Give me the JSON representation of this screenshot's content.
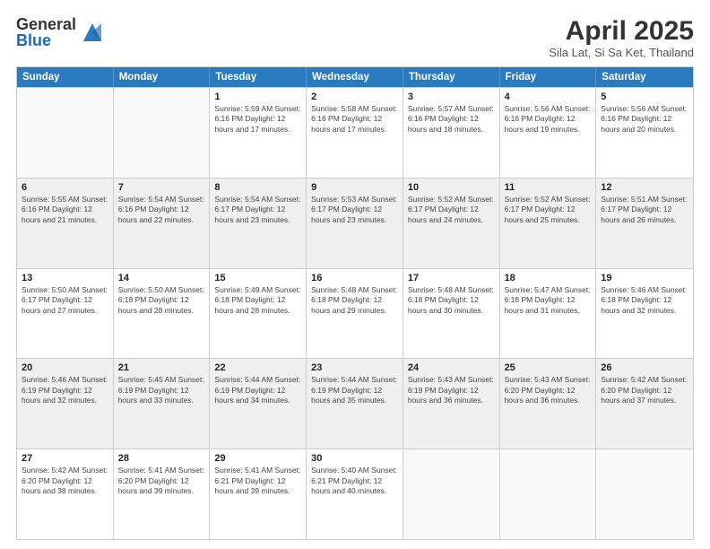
{
  "header": {
    "logo_general": "General",
    "logo_blue": "Blue",
    "title": "April 2025",
    "location": "Sila Lat, Si Sa Ket, Thailand"
  },
  "calendar": {
    "days_of_week": [
      "Sunday",
      "Monday",
      "Tuesday",
      "Wednesday",
      "Thursday",
      "Friday",
      "Saturday"
    ],
    "rows": [
      [
        {
          "day": "",
          "info": ""
        },
        {
          "day": "",
          "info": ""
        },
        {
          "day": "1",
          "info": "Sunrise: 5:59 AM\nSunset: 6:16 PM\nDaylight: 12 hours and 17 minutes."
        },
        {
          "day": "2",
          "info": "Sunrise: 5:58 AM\nSunset: 6:16 PM\nDaylight: 12 hours and 17 minutes."
        },
        {
          "day": "3",
          "info": "Sunrise: 5:57 AM\nSunset: 6:16 PM\nDaylight: 12 hours and 18 minutes."
        },
        {
          "day": "4",
          "info": "Sunrise: 5:56 AM\nSunset: 6:16 PM\nDaylight: 12 hours and 19 minutes."
        },
        {
          "day": "5",
          "info": "Sunrise: 5:56 AM\nSunset: 6:16 PM\nDaylight: 12 hours and 20 minutes."
        }
      ],
      [
        {
          "day": "6",
          "info": "Sunrise: 5:55 AM\nSunset: 6:16 PM\nDaylight: 12 hours and 21 minutes."
        },
        {
          "day": "7",
          "info": "Sunrise: 5:54 AM\nSunset: 6:16 PM\nDaylight: 12 hours and 22 minutes."
        },
        {
          "day": "8",
          "info": "Sunrise: 5:54 AM\nSunset: 6:17 PM\nDaylight: 12 hours and 23 minutes."
        },
        {
          "day": "9",
          "info": "Sunrise: 5:53 AM\nSunset: 6:17 PM\nDaylight: 12 hours and 23 minutes."
        },
        {
          "day": "10",
          "info": "Sunrise: 5:52 AM\nSunset: 6:17 PM\nDaylight: 12 hours and 24 minutes."
        },
        {
          "day": "11",
          "info": "Sunrise: 5:52 AM\nSunset: 6:17 PM\nDaylight: 12 hours and 25 minutes."
        },
        {
          "day": "12",
          "info": "Sunrise: 5:51 AM\nSunset: 6:17 PM\nDaylight: 12 hours and 26 minutes."
        }
      ],
      [
        {
          "day": "13",
          "info": "Sunrise: 5:50 AM\nSunset: 6:17 PM\nDaylight: 12 hours and 27 minutes."
        },
        {
          "day": "14",
          "info": "Sunrise: 5:50 AM\nSunset: 6:18 PM\nDaylight: 12 hours and 28 minutes."
        },
        {
          "day": "15",
          "info": "Sunrise: 5:49 AM\nSunset: 6:18 PM\nDaylight: 12 hours and 28 minutes."
        },
        {
          "day": "16",
          "info": "Sunrise: 5:48 AM\nSunset: 6:18 PM\nDaylight: 12 hours and 29 minutes."
        },
        {
          "day": "17",
          "info": "Sunrise: 5:48 AM\nSunset: 6:18 PM\nDaylight: 12 hours and 30 minutes."
        },
        {
          "day": "18",
          "info": "Sunrise: 5:47 AM\nSunset: 6:18 PM\nDaylight: 12 hours and 31 minutes."
        },
        {
          "day": "19",
          "info": "Sunrise: 5:46 AM\nSunset: 6:18 PM\nDaylight: 12 hours and 32 minutes."
        }
      ],
      [
        {
          "day": "20",
          "info": "Sunrise: 5:46 AM\nSunset: 6:19 PM\nDaylight: 12 hours and 32 minutes."
        },
        {
          "day": "21",
          "info": "Sunrise: 5:45 AM\nSunset: 6:19 PM\nDaylight: 12 hours and 33 minutes."
        },
        {
          "day": "22",
          "info": "Sunrise: 5:44 AM\nSunset: 6:19 PM\nDaylight: 12 hours and 34 minutes."
        },
        {
          "day": "23",
          "info": "Sunrise: 5:44 AM\nSunset: 6:19 PM\nDaylight: 12 hours and 35 minutes."
        },
        {
          "day": "24",
          "info": "Sunrise: 5:43 AM\nSunset: 6:19 PM\nDaylight: 12 hours and 36 minutes."
        },
        {
          "day": "25",
          "info": "Sunrise: 5:43 AM\nSunset: 6:20 PM\nDaylight: 12 hours and 36 minutes."
        },
        {
          "day": "26",
          "info": "Sunrise: 5:42 AM\nSunset: 6:20 PM\nDaylight: 12 hours and 37 minutes."
        }
      ],
      [
        {
          "day": "27",
          "info": "Sunrise: 5:42 AM\nSunset: 6:20 PM\nDaylight: 12 hours and 38 minutes."
        },
        {
          "day": "28",
          "info": "Sunrise: 5:41 AM\nSunset: 6:20 PM\nDaylight: 12 hours and 39 minutes."
        },
        {
          "day": "29",
          "info": "Sunrise: 5:41 AM\nSunset: 6:21 PM\nDaylight: 12 hours and 39 minutes."
        },
        {
          "day": "30",
          "info": "Sunrise: 5:40 AM\nSunset: 6:21 PM\nDaylight: 12 hours and 40 minutes."
        },
        {
          "day": "",
          "info": ""
        },
        {
          "day": "",
          "info": ""
        },
        {
          "day": "",
          "info": ""
        }
      ]
    ]
  }
}
